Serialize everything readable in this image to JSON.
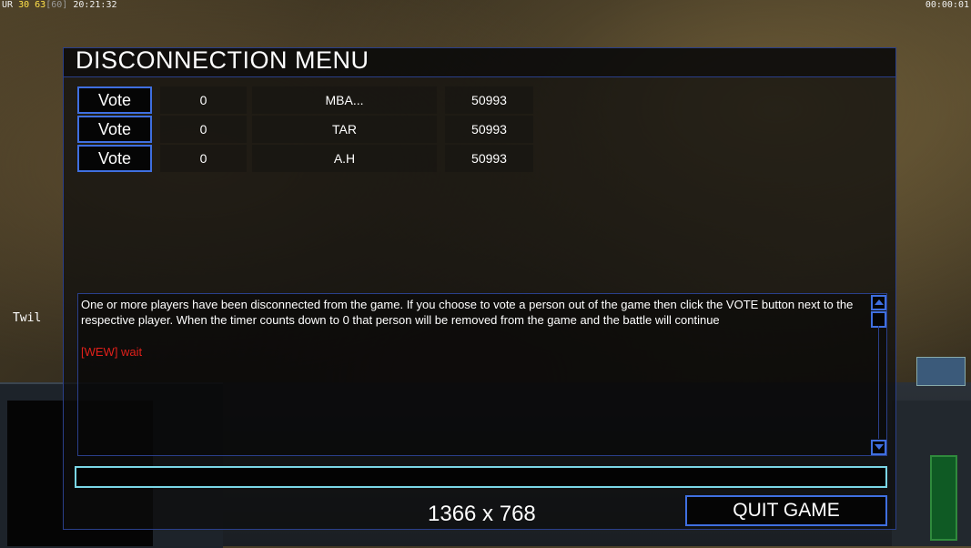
{
  "hud": {
    "ur_label": "UR",
    "ur_a": "30",
    "ur_b": "63",
    "ur_c": "[60]",
    "clock": "20:21:32",
    "timer": "00:00:01",
    "side_player": "Twil"
  },
  "menu": {
    "title": "DISCONNECTION MENU",
    "players": [
      {
        "vote_label": "Vote",
        "count": "0",
        "name": "MBA...",
        "ping": "50993"
      },
      {
        "vote_label": "Vote",
        "count": "0",
        "name": "TAR",
        "ping": "50993"
      },
      {
        "vote_label": "Vote",
        "count": "0",
        "name": "A.H",
        "ping": "50993"
      }
    ],
    "message": "One or more players have been disconnected from the game. If you choose to vote a person out of the game then click the VOTE button next to the respective player. When the timer counts down to 0 that person will be removed from the game and the battle will continue",
    "chat_line": "[WEW] wait",
    "chat_input_value": "",
    "quit_label": "QUIT GAME"
  },
  "overlay": {
    "resolution": "1366 x 768"
  },
  "colors": {
    "border_blue": "#3f6fe0",
    "frame_blue": "#2a3f8a",
    "input_cyan": "#7ad6e6",
    "wait_red": "#e0201a"
  }
}
